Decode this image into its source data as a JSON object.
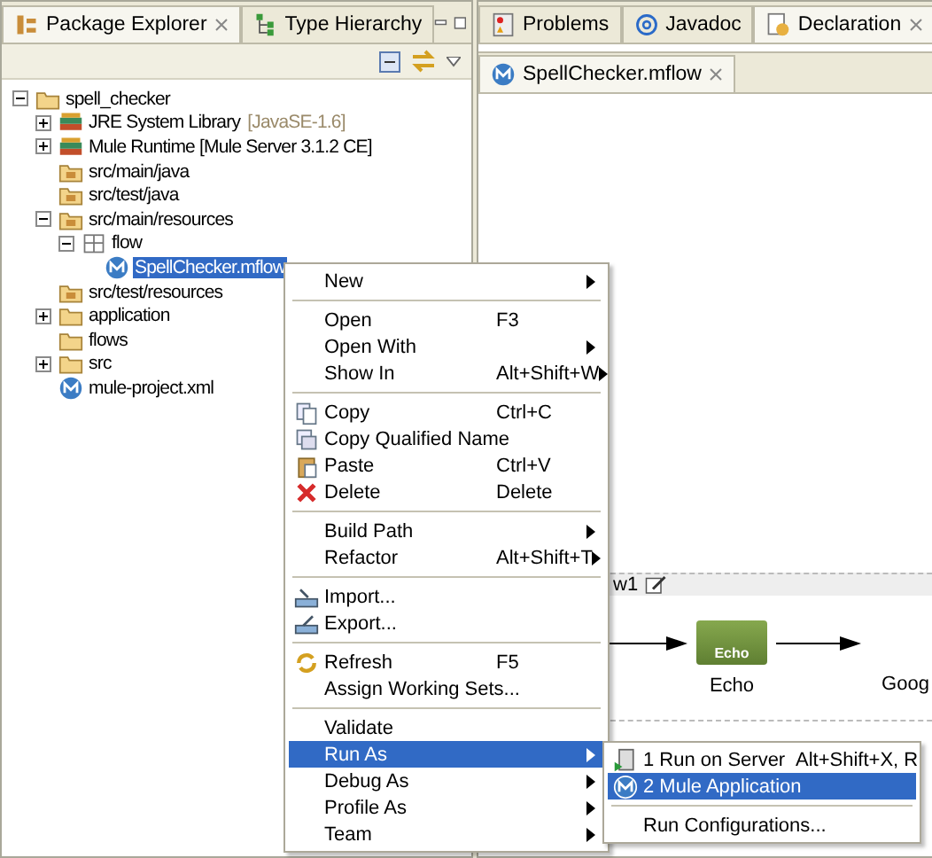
{
  "left_panel": {
    "tabs": [
      {
        "label": "Package Explorer",
        "selected": true,
        "kind": "package-explorer"
      },
      {
        "label": "Type Hierarchy",
        "selected": false,
        "kind": "hierarchy"
      }
    ],
    "tree": [
      {
        "label": "spell_checker",
        "kind": "project",
        "expanded": true,
        "selected": false,
        "children": [
          {
            "label": "JRE System Library",
            "decoration": "[JavaSE-1.6]",
            "kind": "library",
            "expanded": false,
            "selected": false
          },
          {
            "label": "Mule Runtime [Mule Server 3.1.2 CE]",
            "kind": "library",
            "expanded": false,
            "selected": false
          },
          {
            "label": "src/main/java",
            "kind": "source-folder",
            "selected": false
          },
          {
            "label": "src/test/java",
            "kind": "source-folder",
            "selected": false
          },
          {
            "label": "src/main/resources",
            "kind": "source-folder",
            "expanded": true,
            "selected": false,
            "children": [
              {
                "label": "flow",
                "kind": "package",
                "expanded": true,
                "selected": false,
                "children": [
                  {
                    "label": "SpellChecker.mflow",
                    "kind": "mule-file",
                    "selected": true
                  }
                ]
              }
            ]
          },
          {
            "label": "src/test/resources",
            "kind": "source-folder",
            "selected": false
          },
          {
            "label": "application",
            "kind": "folder",
            "expanded": false,
            "selected": false
          },
          {
            "label": "flows",
            "kind": "folder",
            "selected": false
          },
          {
            "label": "src",
            "kind": "folder",
            "expanded": false,
            "selected": false
          },
          {
            "label": "mule-project.xml",
            "kind": "mule-file",
            "selected": false
          }
        ]
      }
    ]
  },
  "right_panel": {
    "tabs": [
      {
        "label": "Problems",
        "selected": false,
        "kind": "problems"
      },
      {
        "label": "Javadoc",
        "selected": false,
        "kind": "javadoc"
      },
      {
        "label": "Declaration",
        "selected": true,
        "kind": "declaration"
      }
    ],
    "editor_tabs": [
      {
        "label": "SpellChecker.mflow",
        "selected": true
      }
    ],
    "canvas": {
      "flow_name": "w1",
      "nodes": [
        {
          "label": "Echo",
          "badge": "Echo"
        },
        {
          "label": "Goog"
        }
      ]
    }
  },
  "context_menu": {
    "groups": [
      [
        {
          "label": "New",
          "submenu": true,
          "selected": false
        }
      ],
      [
        {
          "label": "Open",
          "shortcut": "F3",
          "selected": false
        },
        {
          "label": "Open With",
          "submenu": true,
          "selected": false
        },
        {
          "label": "Show In",
          "shortcut": "Alt+Shift+W",
          "submenu": true,
          "selected": false
        }
      ],
      [
        {
          "label": "Copy",
          "shortcut": "Ctrl+C",
          "kind": "copy",
          "selected": false
        },
        {
          "label": "Copy Qualified Name",
          "kind": "copy-name",
          "selected": false
        },
        {
          "label": "Paste",
          "shortcut": "Ctrl+V",
          "kind": "paste",
          "selected": false
        },
        {
          "label": "Delete",
          "shortcut": "Delete",
          "kind": "delete",
          "selected": false
        }
      ],
      [
        {
          "label": "Build Path",
          "submenu": true,
          "selected": false
        },
        {
          "label": "Refactor",
          "shortcut": "Alt+Shift+T",
          "submenu": true,
          "selected": false
        }
      ],
      [
        {
          "label": "Import...",
          "kind": "import",
          "selected": false
        },
        {
          "label": "Export...",
          "kind": "export",
          "selected": false
        }
      ],
      [
        {
          "label": "Refresh",
          "shortcut": "F5",
          "kind": "refresh",
          "selected": false
        },
        {
          "label": "Assign Working Sets...",
          "selected": false
        }
      ],
      [
        {
          "label": "Validate",
          "selected": false
        },
        {
          "label": "Run As",
          "submenu": true,
          "selected": true
        },
        {
          "label": "Debug As",
          "submenu": true,
          "selected": false
        },
        {
          "label": "Profile As",
          "submenu": true,
          "selected": false
        },
        {
          "label": "Team",
          "submenu": true,
          "selected": false
        }
      ]
    ]
  },
  "submenu": {
    "groups": [
      [
        {
          "label": "1 Run on Server",
          "shortcut": "Alt+Shift+X, R",
          "kind": "server",
          "selected": false
        },
        {
          "label": "2 Mule Application",
          "kind": "mule",
          "selected": true
        }
      ],
      [
        {
          "label": "Run Configurations...",
          "selected": false
        }
      ]
    ]
  }
}
